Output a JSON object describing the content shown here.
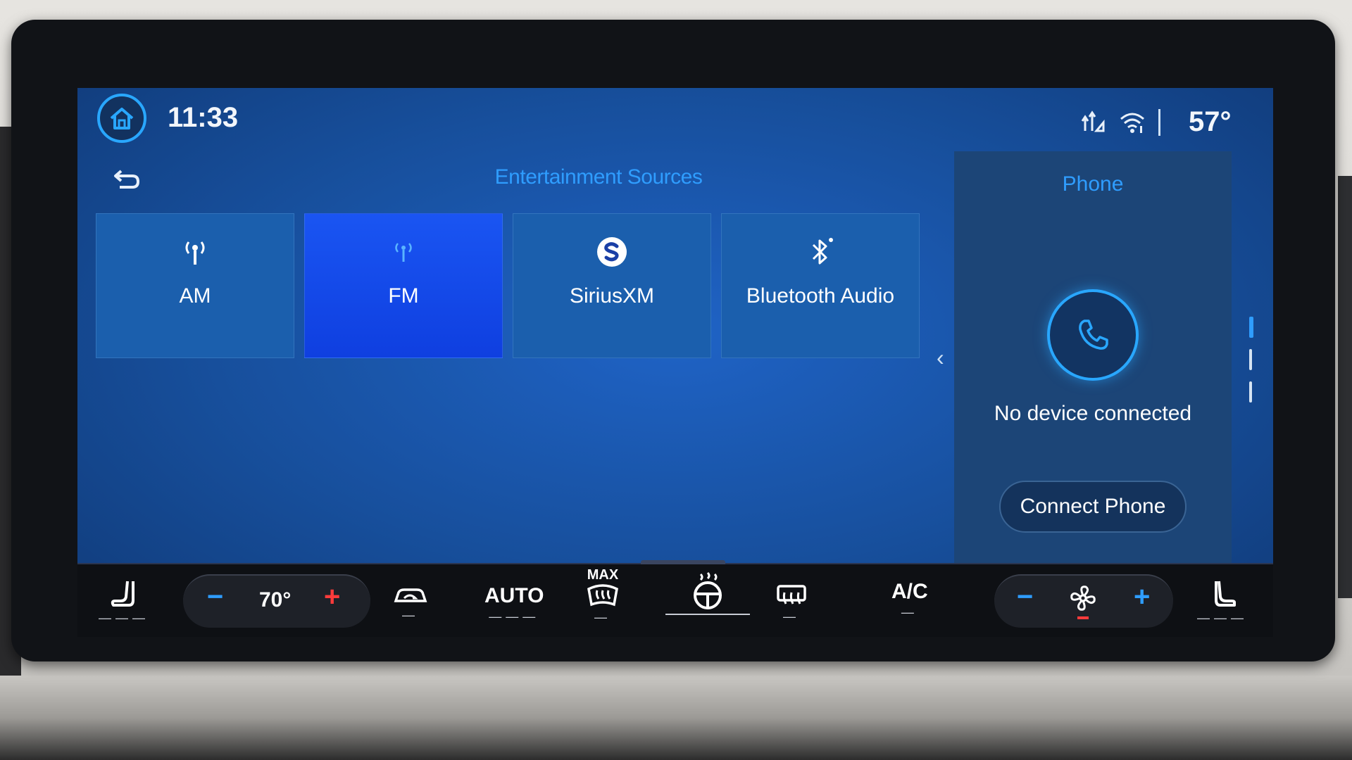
{
  "status_bar": {
    "time": "11:33",
    "outside_temp": "57°",
    "icons": [
      "home-icon",
      "signal-icon",
      "wifi-icon"
    ]
  },
  "entertainment": {
    "title": "Entertainment Sources",
    "back_icon": "back-arrow-icon",
    "sources": [
      {
        "label": "AM",
        "icon": "am-antenna-icon",
        "active": false
      },
      {
        "label": "FM",
        "icon": "fm-antenna-icon",
        "active": true
      },
      {
        "label": "SiriusXM",
        "icon": "siriusxm-icon",
        "active": false
      },
      {
        "label": "Bluetooth Audio",
        "icon": "bluetooth-icon",
        "active": false
      }
    ]
  },
  "phone": {
    "title": "Phone",
    "status": "No device connected",
    "connect_label": "Connect Phone",
    "icon": "phone-icon"
  },
  "climate": {
    "driver_temp": "70°",
    "auto_label": "AUTO",
    "max_label": "MAX",
    "ac_label": "A/C",
    "icons": [
      "driver-seat-icon",
      "recirculation-icon",
      "max-defrost-icon",
      "heated-steering-icon",
      "rear-defrost-icon",
      "fan-icon",
      "passenger-seat-icon"
    ]
  },
  "colors": {
    "accent_blue": "#2f9dff",
    "active_tile": "#1a55f2",
    "temp_plus": "#ff3b3b"
  }
}
